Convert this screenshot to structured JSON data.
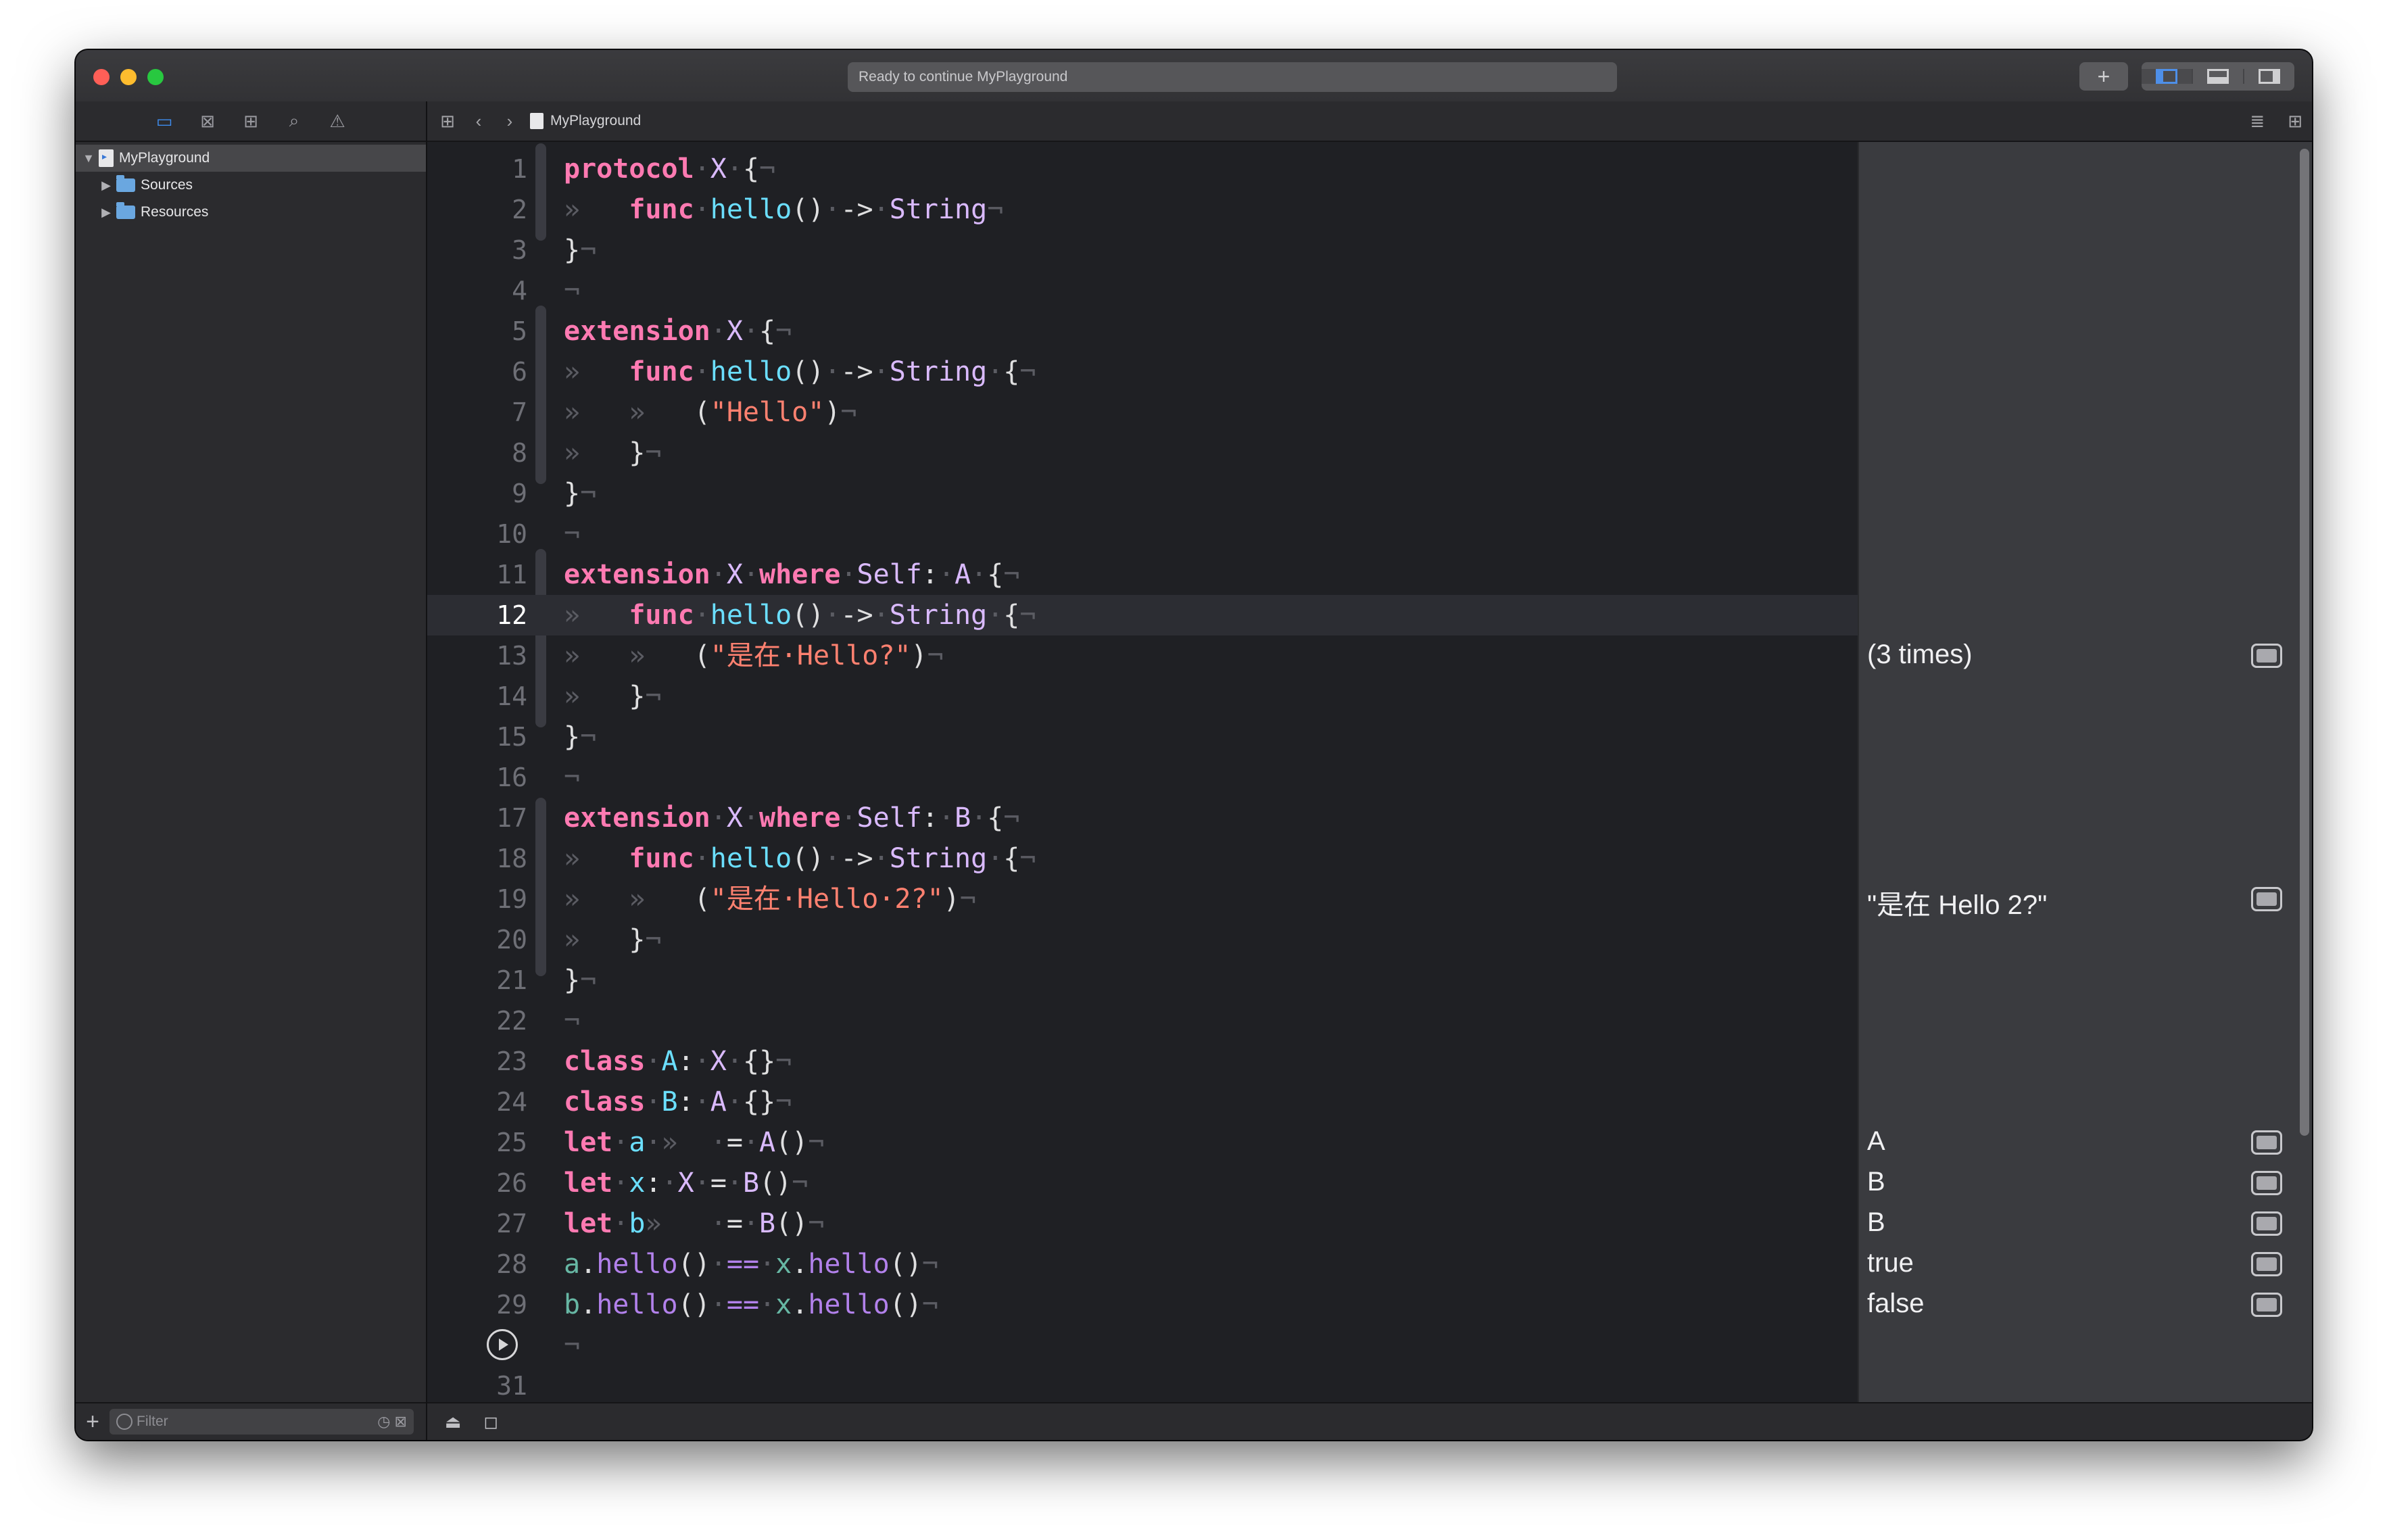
{
  "window": {
    "activity": "Ready to continue MyPlayground",
    "add_label": "+"
  },
  "navigator": {
    "icons": [
      "folder-icon",
      "source-control-icon",
      "hierarchy-icon",
      "search-icon",
      "warning-icon"
    ],
    "items": [
      {
        "label": "MyPlayground",
        "expanded": "▼",
        "kind": "playground"
      },
      {
        "label": "Sources",
        "expanded": "▶",
        "kind": "folder"
      },
      {
        "label": "Resources",
        "expanded": "▶",
        "kind": "folder"
      }
    ],
    "filter_placeholder": "Filter"
  },
  "jumpbar": {
    "file": "MyPlayground"
  },
  "editor": {
    "current_line": 12,
    "lines": [
      {
        "n": "1",
        "seg": [
          [
            "kw",
            "protocol"
          ],
          [
            "ws",
            "·"
          ],
          [
            "typ",
            "X"
          ],
          [
            "ws",
            "·"
          ],
          [
            "plain",
            "{"
          ],
          [
            "ws",
            "¬"
          ]
        ]
      },
      {
        "n": "2",
        "seg": [
          [
            "ws",
            "»   "
          ],
          [
            "kw",
            "func"
          ],
          [
            "ws",
            "·"
          ],
          [
            "fn",
            "hello"
          ],
          [
            "plain",
            "()"
          ],
          [
            "ws",
            "·"
          ],
          [
            "plain",
            "->"
          ],
          [
            "ws",
            "·"
          ],
          [
            "typ",
            "String"
          ],
          [
            "ws",
            "¬"
          ]
        ]
      },
      {
        "n": "3",
        "seg": [
          [
            "plain",
            "}"
          ],
          [
            "ws",
            "¬"
          ]
        ]
      },
      {
        "n": "4",
        "seg": [
          [
            "ws",
            "¬"
          ]
        ]
      },
      {
        "n": "5",
        "seg": [
          [
            "kw",
            "extension"
          ],
          [
            "ws",
            "·"
          ],
          [
            "typ",
            "X"
          ],
          [
            "ws",
            "·"
          ],
          [
            "plain",
            "{"
          ],
          [
            "ws",
            "¬"
          ]
        ]
      },
      {
        "n": "6",
        "seg": [
          [
            "ws",
            "»   "
          ],
          [
            "kw",
            "func"
          ],
          [
            "ws",
            "·"
          ],
          [
            "fn",
            "hello"
          ],
          [
            "plain",
            "()"
          ],
          [
            "ws",
            "·"
          ],
          [
            "plain",
            "->"
          ],
          [
            "ws",
            "·"
          ],
          [
            "typ",
            "String"
          ],
          [
            "ws",
            "·"
          ],
          [
            "plain",
            "{"
          ],
          [
            "ws",
            "¬"
          ]
        ]
      },
      {
        "n": "7",
        "seg": [
          [
            "ws",
            "»   »   "
          ],
          [
            "plain",
            "("
          ],
          [
            "str",
            "\"Hello\""
          ],
          [
            "plain",
            ")"
          ],
          [
            "ws",
            "¬"
          ]
        ]
      },
      {
        "n": "8",
        "seg": [
          [
            "ws",
            "»   "
          ],
          [
            "plain",
            "}"
          ],
          [
            "ws",
            "¬"
          ]
        ]
      },
      {
        "n": "9",
        "seg": [
          [
            "plain",
            "}"
          ],
          [
            "ws",
            "¬"
          ]
        ]
      },
      {
        "n": "10",
        "seg": [
          [
            "ws",
            "¬"
          ]
        ]
      },
      {
        "n": "11",
        "seg": [
          [
            "kw",
            "extension"
          ],
          [
            "ws",
            "·"
          ],
          [
            "typ",
            "X"
          ],
          [
            "ws",
            "·"
          ],
          [
            "kw",
            "where"
          ],
          [
            "ws",
            "·"
          ],
          [
            "typ",
            "Self"
          ],
          [
            "plain",
            ":"
          ],
          [
            "ws",
            "·"
          ],
          [
            "typ",
            "A"
          ],
          [
            "ws",
            "·"
          ],
          [
            "plain",
            "{"
          ],
          [
            "ws",
            "¬"
          ]
        ]
      },
      {
        "n": "12",
        "seg": [
          [
            "ws",
            "»   "
          ],
          [
            "kw",
            "func"
          ],
          [
            "ws",
            "·"
          ],
          [
            "fn",
            "hello"
          ],
          [
            "plain",
            "()"
          ],
          [
            "ws",
            "·"
          ],
          [
            "plain",
            "->"
          ],
          [
            "ws",
            "·"
          ],
          [
            "typ",
            "String"
          ],
          [
            "ws",
            "·"
          ],
          [
            "plain",
            "{"
          ],
          [
            "ws",
            "¬"
          ]
        ]
      },
      {
        "n": "13",
        "seg": [
          [
            "ws",
            "»   »   "
          ],
          [
            "plain",
            "("
          ],
          [
            "str",
            "\"是在·Hello?\""
          ],
          [
            "plain",
            ")"
          ],
          [
            "ws",
            "¬"
          ]
        ]
      },
      {
        "n": "14",
        "seg": [
          [
            "ws",
            "»   "
          ],
          [
            "plain",
            "}"
          ],
          [
            "ws",
            "¬"
          ]
        ]
      },
      {
        "n": "15",
        "seg": [
          [
            "plain",
            "}"
          ],
          [
            "ws",
            "¬"
          ]
        ]
      },
      {
        "n": "16",
        "seg": [
          [
            "ws",
            "¬"
          ]
        ]
      },
      {
        "n": "17",
        "seg": [
          [
            "kw",
            "extension"
          ],
          [
            "ws",
            "·"
          ],
          [
            "typ",
            "X"
          ],
          [
            "ws",
            "·"
          ],
          [
            "kw",
            "where"
          ],
          [
            "ws",
            "·"
          ],
          [
            "typ",
            "Self"
          ],
          [
            "plain",
            ":"
          ],
          [
            "ws",
            "·"
          ],
          [
            "typ",
            "B"
          ],
          [
            "ws",
            "·"
          ],
          [
            "plain",
            "{"
          ],
          [
            "ws",
            "¬"
          ]
        ]
      },
      {
        "n": "18",
        "seg": [
          [
            "ws",
            "»   "
          ],
          [
            "kw",
            "func"
          ],
          [
            "ws",
            "·"
          ],
          [
            "fn",
            "hello"
          ],
          [
            "plain",
            "()"
          ],
          [
            "ws",
            "·"
          ],
          [
            "plain",
            "->"
          ],
          [
            "ws",
            "·"
          ],
          [
            "typ",
            "String"
          ],
          [
            "ws",
            "·"
          ],
          [
            "plain",
            "{"
          ],
          [
            "ws",
            "¬"
          ]
        ]
      },
      {
        "n": "19",
        "seg": [
          [
            "ws",
            "»   »   "
          ],
          [
            "plain",
            "("
          ],
          [
            "str",
            "\"是在·Hello·2?\""
          ],
          [
            "plain",
            ")"
          ],
          [
            "ws",
            "¬"
          ]
        ]
      },
      {
        "n": "20",
        "seg": [
          [
            "ws",
            "»   "
          ],
          [
            "plain",
            "}"
          ],
          [
            "ws",
            "¬"
          ]
        ]
      },
      {
        "n": "21",
        "seg": [
          [
            "plain",
            "}"
          ],
          [
            "ws",
            "¬"
          ]
        ]
      },
      {
        "n": "22",
        "seg": [
          [
            "ws",
            "¬"
          ]
        ]
      },
      {
        "n": "23",
        "seg": [
          [
            "kw",
            "class"
          ],
          [
            "ws",
            "·"
          ],
          [
            "fn",
            "A"
          ],
          [
            "plain",
            ":"
          ],
          [
            "ws",
            "·"
          ],
          [
            "typ",
            "X"
          ],
          [
            "ws",
            "·"
          ],
          [
            "plain",
            "{}"
          ],
          [
            "ws",
            "¬"
          ]
        ]
      },
      {
        "n": "24",
        "seg": [
          [
            "kw",
            "class"
          ],
          [
            "ws",
            "·"
          ],
          [
            "fn",
            "B"
          ],
          [
            "plain",
            ":"
          ],
          [
            "ws",
            "·"
          ],
          [
            "typ",
            "A"
          ],
          [
            "ws",
            "·"
          ],
          [
            "plain",
            "{}"
          ],
          [
            "ws",
            "¬"
          ]
        ]
      },
      {
        "n": "25",
        "seg": [
          [
            "kw",
            "let"
          ],
          [
            "ws",
            "·"
          ],
          [
            "fn",
            "a"
          ],
          [
            "ws",
            "·»  ·"
          ],
          [
            "plain",
            "="
          ],
          [
            "ws",
            "·"
          ],
          [
            "typ",
            "A"
          ],
          [
            "plain",
            "()"
          ],
          [
            "ws",
            "¬"
          ]
        ]
      },
      {
        "n": "26",
        "seg": [
          [
            "kw",
            "let"
          ],
          [
            "ws",
            "·"
          ],
          [
            "fn",
            "x"
          ],
          [
            "plain",
            ":"
          ],
          [
            "ws",
            "·"
          ],
          [
            "typ",
            "X"
          ],
          [
            "ws",
            "·"
          ],
          [
            "plain",
            "="
          ],
          [
            "ws",
            "·"
          ],
          [
            "typ",
            "B"
          ],
          [
            "plain",
            "()"
          ],
          [
            "ws",
            "¬"
          ]
        ]
      },
      {
        "n": "27",
        "seg": [
          [
            "kw",
            "let"
          ],
          [
            "ws",
            "·"
          ],
          [
            "fn",
            "b"
          ],
          [
            "ws",
            "»   ·"
          ],
          [
            "plain",
            "="
          ],
          [
            "ws",
            "·"
          ],
          [
            "typ",
            "B"
          ],
          [
            "plain",
            "()"
          ],
          [
            "ws",
            "¬"
          ]
        ]
      },
      {
        "n": "28",
        "seg": [
          [
            "ident",
            "a"
          ],
          [
            "plain",
            "."
          ],
          [
            "call",
            "hello"
          ],
          [
            "plain",
            "()"
          ],
          [
            "ws",
            "·"
          ],
          [
            "call",
            "=="
          ],
          [
            "ws",
            "·"
          ],
          [
            "ident",
            "x"
          ],
          [
            "plain",
            "."
          ],
          [
            "call",
            "hello"
          ],
          [
            "plain",
            "()"
          ],
          [
            "ws",
            "¬"
          ]
        ]
      },
      {
        "n": "29",
        "seg": [
          [
            "ident",
            "b"
          ],
          [
            "plain",
            "."
          ],
          [
            "call",
            "hello"
          ],
          [
            "plain",
            "()"
          ],
          [
            "ws",
            "·"
          ],
          [
            "call",
            "=="
          ],
          [
            "ws",
            "·"
          ],
          [
            "ident",
            "x"
          ],
          [
            "plain",
            "."
          ],
          [
            "call",
            "hello"
          ],
          [
            "plain",
            "()"
          ],
          [
            "ws",
            "¬"
          ]
        ]
      },
      {
        "n": "",
        "seg": [
          [
            "ws",
            "¬"
          ]
        ]
      },
      {
        "n": "31",
        "seg": []
      }
    ]
  },
  "results": [
    {
      "line": 13,
      "text": "(3 times)"
    },
    {
      "line": 19,
      "text": "\"是在 Hello 2?\""
    },
    {
      "line": 25,
      "text": "A"
    },
    {
      "line": 26,
      "text": "B"
    },
    {
      "line": 27,
      "text": "B"
    },
    {
      "line": 28,
      "text": "true"
    },
    {
      "line": 29,
      "text": "false"
    }
  ],
  "colors": {
    "keyword": "#ff7ab2",
    "type": "#dabaff",
    "function": "#6bdfff",
    "string": "#ff8170",
    "accent": "#3e8df0"
  }
}
